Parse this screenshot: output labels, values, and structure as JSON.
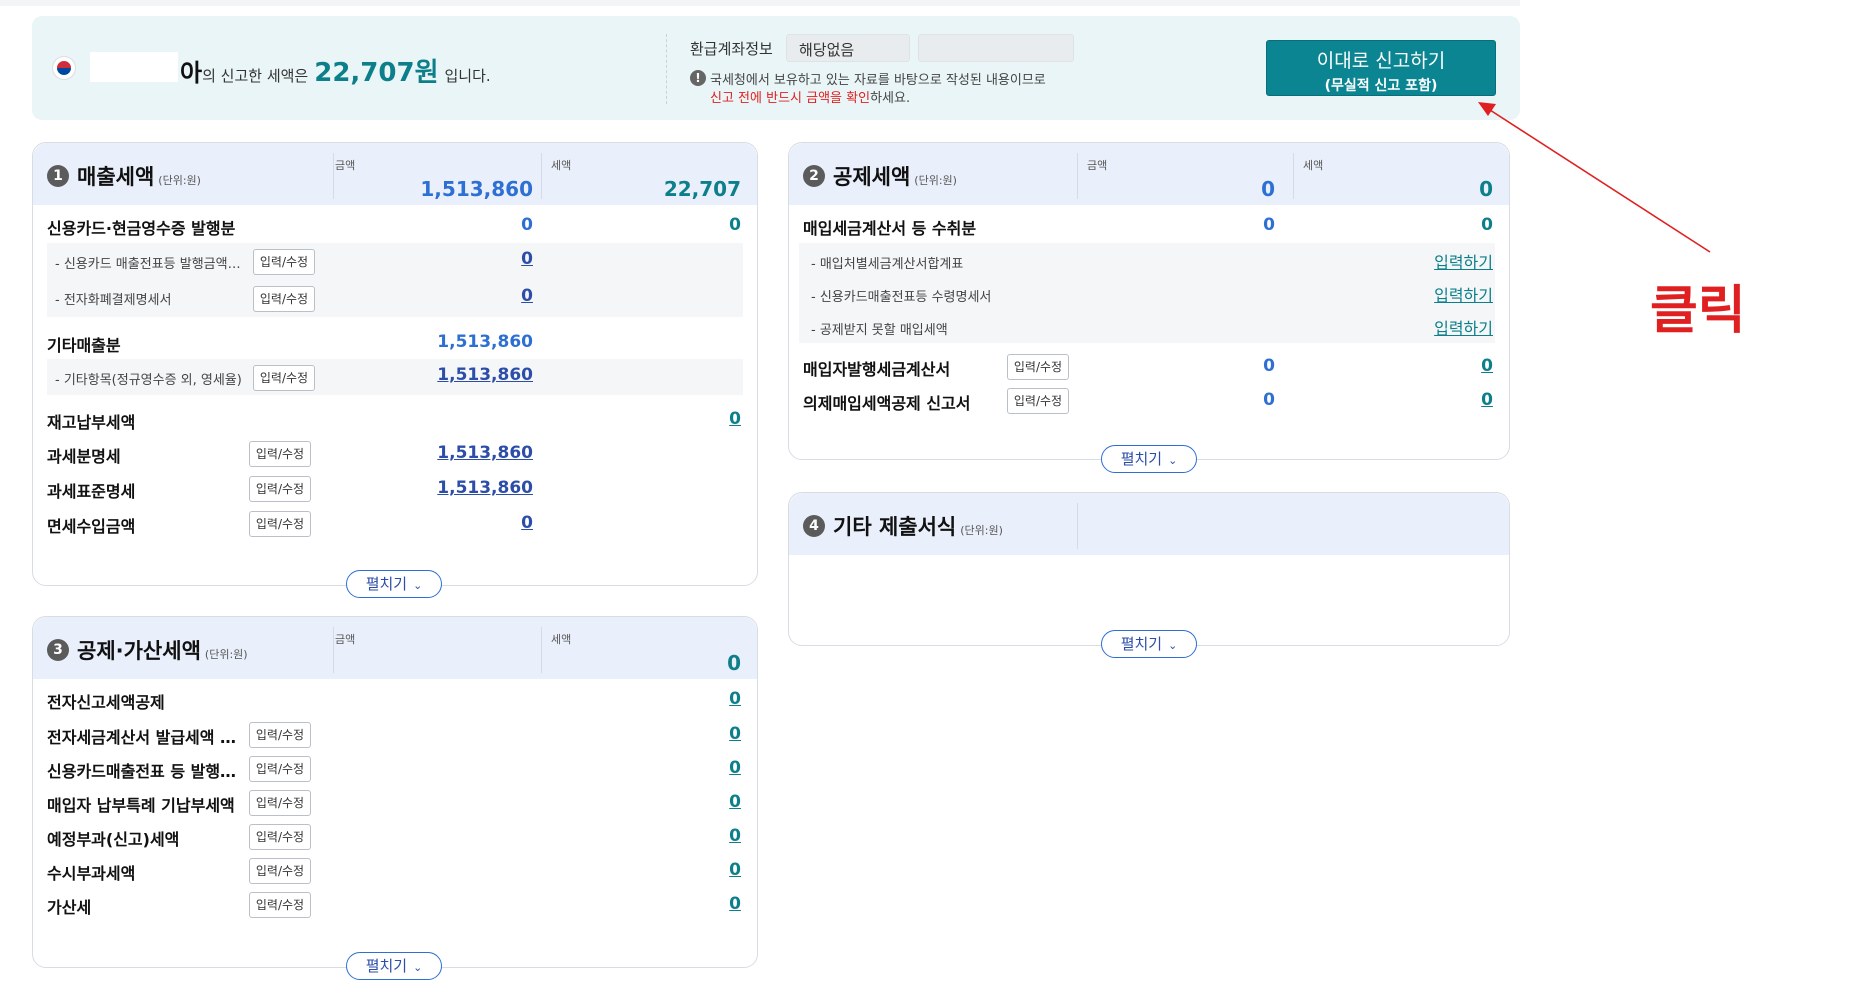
{
  "summary": {
    "name_suffix": "아",
    "text_before": "의 신고한 세액은 ",
    "amount": "22,707원",
    "text_after": " 입니다.",
    "refund_label": "환급계좌정보",
    "refund_value": "해당없음",
    "refund_account": "",
    "warning_line1": "국세청에서 보유하고 있는 자료를 바탕으로 작성된 내용이므로",
    "warning_line2_red": "신고 전에 반드시 금액을 확인",
    "warning_line2_rest": "하세요.",
    "submit_line1": "이대로 신고하기",
    "submit_line2": "(무실적 신고 포함)"
  },
  "annotation": {
    "label": "클릭",
    "color": "#e02020"
  },
  "common": {
    "edit_label": "입력/수정",
    "input_label": "입력하기",
    "expand_label": "펼치기",
    "amount_label": "금액",
    "tax_label": "세액",
    "unit_label": "(단위:원)"
  },
  "sales": {
    "num": "1",
    "title": "매출세액",
    "amount_total": "1,513,860",
    "tax_total": "22,707",
    "rows": [
      {
        "label": "신용카드·현금영수증 발행분",
        "amount": "0",
        "tax": "0"
      },
      {
        "label": "- 신용카드 매출전표등 발행금액…",
        "amount": "0"
      },
      {
        "label": "- 전자화폐결제명세서",
        "amount": "0"
      },
      {
        "label": "기타매출분",
        "amount": "1,513,860"
      },
      {
        "label": "- 기타항목(정규영수증 외, 영세율)",
        "amount": "1,513,860"
      },
      {
        "label": "재고납부세액",
        "tax": "0"
      },
      {
        "label": "과세분명세",
        "amount": "1,513,860"
      },
      {
        "label": "과세표준명세",
        "amount": "1,513,860"
      },
      {
        "label": "면세수입금액",
        "amount": "0"
      }
    ]
  },
  "deduction": {
    "num": "2",
    "title": "공제세액",
    "amount_total": "0",
    "tax_total": "0",
    "rows": [
      {
        "label": "매입세금계산서 등 수취분",
        "amount": "0",
        "tax": "0"
      },
      {
        "label": "- 매입처별세금계산서합계표"
      },
      {
        "label": "- 신용카드매출전표등 수령명세서"
      },
      {
        "label": "- 공제받지 못할 매입세액"
      },
      {
        "label": "매입자발행세금계산서",
        "amount": "0",
        "tax": "0"
      },
      {
        "label": "의제매입세액공제 신고서",
        "amount": "0",
        "tax": "0"
      }
    ]
  },
  "deduct_add": {
    "num": "3",
    "title": "공제·가산세액",
    "tax_total": "0",
    "rows": [
      {
        "label": "전자신고세액공제",
        "tax": "0"
      },
      {
        "label": "전자세금계산서 발급세액 …",
        "tax": "0"
      },
      {
        "label": "신용카드매출전표 등 발행…",
        "tax": "0"
      },
      {
        "label": "매입자 납부특례 기납부세액",
        "tax": "0"
      },
      {
        "label": "예정부과(신고)세액",
        "tax": "0"
      },
      {
        "label": "수시부과세액",
        "tax": "0"
      },
      {
        "label": "가산세",
        "tax": "0"
      }
    ]
  },
  "other": {
    "num": "4",
    "title": "기타 제출서식"
  }
}
